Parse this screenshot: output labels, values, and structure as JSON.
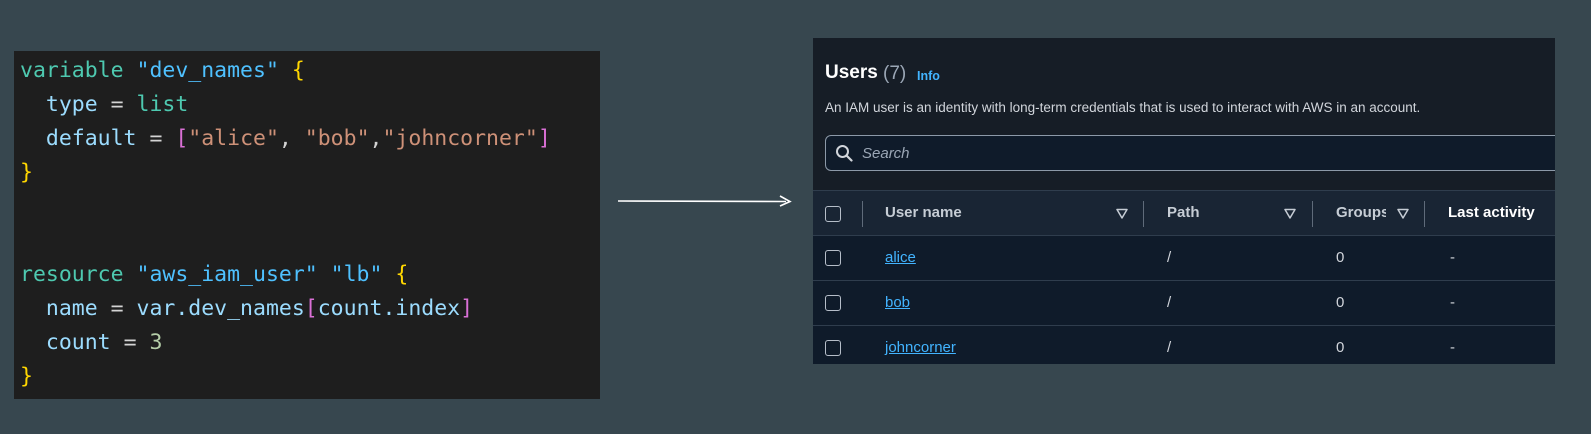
{
  "code": {
    "lines": [
      [
        {
          "t": "variable ",
          "c": "kw"
        },
        {
          "t": "\"dev_names\" ",
          "c": "str"
        },
        {
          "t": "{",
          "c": "brace"
        }
      ],
      [
        {
          "t": "  type ",
          "c": "attr"
        },
        {
          "t": "= ",
          "c": "eq"
        },
        {
          "t": "list",
          "c": "val"
        }
      ],
      [
        {
          "t": "  default ",
          "c": "attr"
        },
        {
          "t": "= ",
          "c": "eq"
        },
        {
          "t": "[",
          "c": "bracket"
        },
        {
          "t": "\"alice\"",
          "c": "strval"
        },
        {
          "t": ", ",
          "c": "eq"
        },
        {
          "t": "\"bob\"",
          "c": "strval"
        },
        {
          "t": ",",
          "c": "eq"
        },
        {
          "t": "\"johncorner\"",
          "c": "strval"
        },
        {
          "t": "]",
          "c": "bracket"
        }
      ],
      [
        {
          "t": "}",
          "c": "brace"
        }
      ],
      [],
      [],
      [
        {
          "t": "resource ",
          "c": "kw"
        },
        {
          "t": "\"aws_iam_user\" ",
          "c": "str"
        },
        {
          "t": "\"lb\" ",
          "c": "str"
        },
        {
          "t": "{",
          "c": "brace"
        }
      ],
      [
        {
          "t": "  name ",
          "c": "attr"
        },
        {
          "t": "= ",
          "c": "eq"
        },
        {
          "t": "var.dev_names",
          "c": "attr"
        },
        {
          "t": "[",
          "c": "bracket"
        },
        {
          "t": "count.index",
          "c": "attr"
        },
        {
          "t": "]",
          "c": "bracket"
        }
      ],
      [
        {
          "t": "  count ",
          "c": "attr"
        },
        {
          "t": "= ",
          "c": "eq"
        },
        {
          "t": "3",
          "c": "num"
        }
      ],
      [
        {
          "t": "}",
          "c": "brace"
        }
      ]
    ]
  },
  "aws": {
    "title": "Users",
    "count": "(7)",
    "info": "Info",
    "description": "An IAM user is an identity with long-term credentials that is used to interact with AWS in an account.",
    "search": {
      "placeholder": "Search",
      "value": ""
    },
    "columns": {
      "user_name": "User name",
      "path": "Path",
      "groups": "Groups",
      "last_activity": "Last activity"
    },
    "rows": [
      {
        "user_name": "alice",
        "path": "/",
        "groups": "0",
        "last_activity": "-"
      },
      {
        "user_name": "bob",
        "path": "/",
        "groups": "0",
        "last_activity": "-"
      },
      {
        "user_name": "johncorner",
        "path": "/",
        "groups": "0",
        "last_activity": "-"
      }
    ]
  }
}
